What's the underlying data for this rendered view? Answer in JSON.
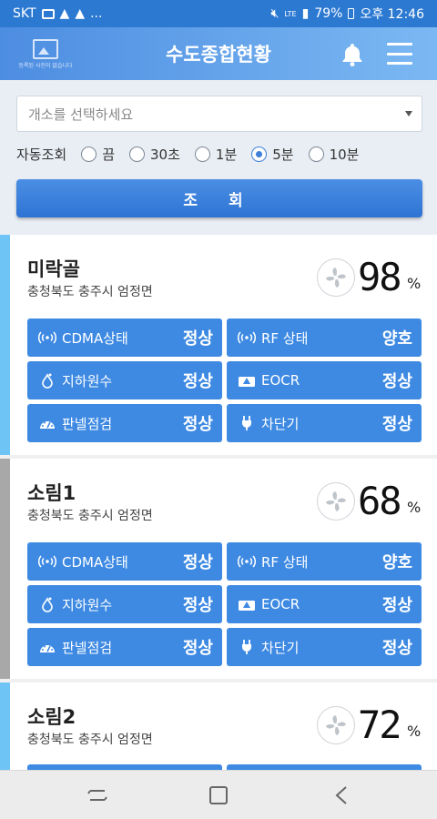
{
  "status_bar": {
    "carrier": "SKT",
    "more": "...",
    "network": "LTE",
    "battery": "79%",
    "time": "오후 12:46"
  },
  "header": {
    "logo_caption": "등록된 사진이 없습니다",
    "title": "수도종합현황"
  },
  "filters": {
    "select_placeholder": "개소를 선택하세요",
    "auto_label": "자동조회",
    "options": [
      {
        "label": "끔",
        "selected": false
      },
      {
        "label": "30초",
        "selected": false
      },
      {
        "label": "1분",
        "selected": false
      },
      {
        "label": "5분",
        "selected": true
      },
      {
        "label": "10분",
        "selected": false
      }
    ],
    "search_button": "조 회"
  },
  "cards": [
    {
      "name": "미락골",
      "address": "충청북도 충주시 엄정면",
      "percent": "98",
      "accent": "#6ec4f5",
      "tiles": [
        {
          "icon": "signal-icon",
          "label": "CDMA상태",
          "status": "정상"
        },
        {
          "icon": "signal-icon",
          "label": "RF 상태",
          "status": "양호"
        },
        {
          "icon": "water-drop-icon",
          "label": "지하원수",
          "status": "정상"
        },
        {
          "icon": "warning-icon",
          "label": "EOCR",
          "status": "정상"
        },
        {
          "icon": "gauge-icon",
          "label": "판넬점검",
          "status": "정상"
        },
        {
          "icon": "plug-icon",
          "label": "차단기",
          "status": "정상"
        }
      ]
    },
    {
      "name": "소림1",
      "address": "충청북도 충주시 엄정면",
      "percent": "68",
      "accent": "#a8a8a8",
      "tiles": [
        {
          "icon": "signal-icon",
          "label": "CDMA상태",
          "status": "정상"
        },
        {
          "icon": "signal-icon",
          "label": "RF 상태",
          "status": "양호"
        },
        {
          "icon": "water-drop-icon",
          "label": "지하원수",
          "status": "정상"
        },
        {
          "icon": "warning-icon",
          "label": "EOCR",
          "status": "정상"
        },
        {
          "icon": "gauge-icon",
          "label": "판넬점검",
          "status": "정상"
        },
        {
          "icon": "plug-icon",
          "label": "차단기",
          "status": "정상"
        }
      ]
    },
    {
      "name": "소림2",
      "address": "충청북도 충주시 엄정면",
      "percent": "72",
      "accent": "#6ec4f5",
      "tiles": []
    }
  ],
  "percent_sign": "%",
  "colors": {
    "appbar_start": "#4d8de1",
    "appbar_end": "#7bb8f3",
    "tile": "#3e8ae3",
    "button": "#2d74d3"
  }
}
